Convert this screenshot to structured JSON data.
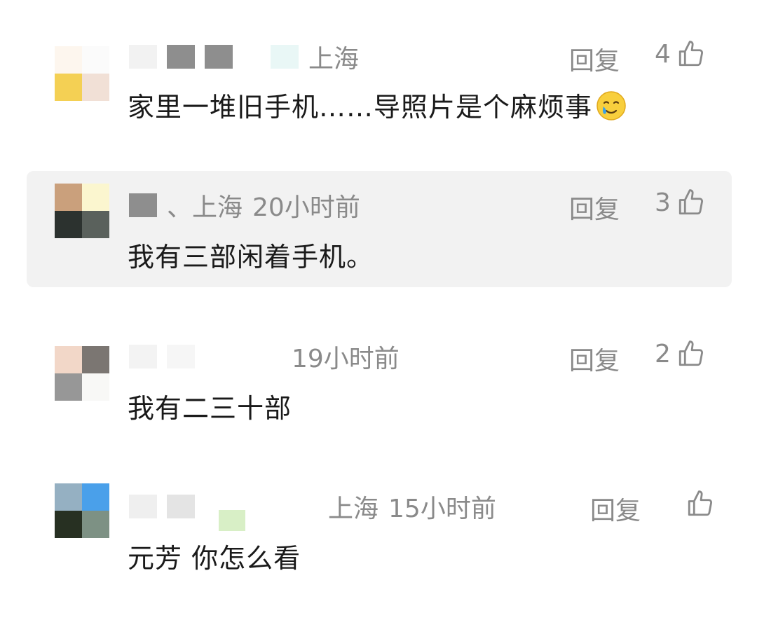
{
  "comments": [
    {
      "location": "上海",
      "time": "",
      "content": "家里一堆旧手机……导照片是个麻烦事",
      "reply_label": "回复",
      "like_count": "4",
      "emoji": "crying-smile-emoji"
    },
    {
      "location": "、上海",
      "time": "20小时前",
      "content": "我有三部闲着手机。",
      "reply_label": "回复",
      "like_count": "3"
    },
    {
      "location": "",
      "time": "19小时前",
      "content": "我有二三十部",
      "reply_label": "回复",
      "like_count": "2"
    },
    {
      "location": "上海",
      "time": "15小时前",
      "content": "元芳 你怎么看",
      "reply_label": "回复",
      "like_count": ""
    }
  ],
  "icons": {
    "like": "thumbs-up-icon"
  },
  "colors": {
    "text": "#1a1a1a",
    "meta": "#8a8a8a",
    "highlight": "#f2f2f2"
  }
}
